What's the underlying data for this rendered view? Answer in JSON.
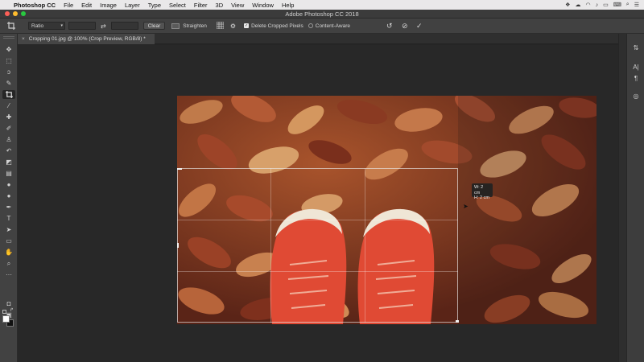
{
  "menubar": {
    "app_name": "Photoshop CC",
    "items": [
      "File",
      "Edit",
      "Image",
      "Layer",
      "Type",
      "Select",
      "Filter",
      "3D",
      "View",
      "Window",
      "Help"
    ]
  },
  "window": {
    "title": "Adobe Photoshop CC 2018"
  },
  "options": {
    "ratio_value": "Ratio",
    "clear_label": "Clear",
    "straighten_label": "Straighten",
    "delete_cropped_label": "Delete Cropped Pixels",
    "content_aware_label": "Content-Aware"
  },
  "document": {
    "tab_title": "Cropping 01.jpg @ 100% (Crop Preview, RGB/8) *"
  },
  "crop_tooltip": {
    "width": "W: 2 cm",
    "height": "H: 2 cm"
  },
  "colors": {
    "foreground": "#ffffff",
    "background": "#111111",
    "accent_leaves": "#b5502f"
  }
}
